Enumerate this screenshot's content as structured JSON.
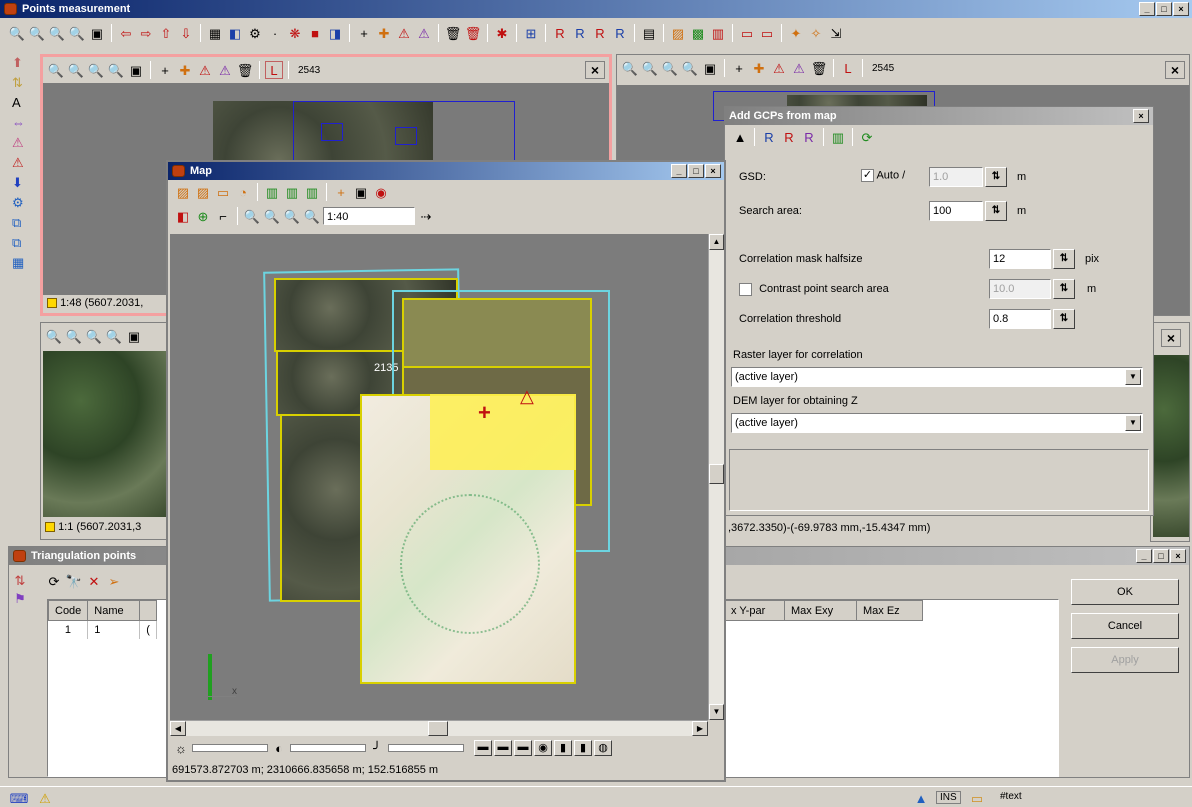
{
  "main_window": {
    "title": "Points measurement",
    "toolbar_icons": [
      "zoom-in-icon",
      "zoom-out-icon",
      "zoom-fit-icon",
      "zoom-area-icon",
      "zoom-box-icon",
      "arrow-left-icon",
      "arrow-right-icon",
      "arrow-up-icon",
      "arrow-down-icon",
      "grid-icon",
      "layer-icon",
      "settings-icon",
      "link-icon",
      "book-icon",
      "color-icon",
      "add-point-icon",
      "add-point-2-icon",
      "triangle-point-icon",
      "triangle-point-2-icon",
      "trash-icon",
      "trash-2-icon",
      "cross-icon",
      "measure-icon",
      "r-icon",
      "r-plus-icon",
      "r-label-icon",
      "r-question-icon",
      "report-icon",
      "map-icon",
      "grid-2-icon",
      "chart-icon",
      "window-icon",
      "window-2-icon",
      "point-tool-icon",
      "points-group-icon",
      "export-icon"
    ]
  },
  "top_left_view": {
    "image_id": "2543",
    "status": "1:48 (5607.2031,"
  },
  "top_right_view": {
    "image_id": "2545"
  },
  "bottom_left_view": {
    "status": "1:1 (5607.2031,3"
  },
  "map_window": {
    "title": "Map",
    "scale_value": "1:40",
    "image_label": "2135",
    "coordinates": "691573.872703 m; 2310666.835658 m; 152.516855 m"
  },
  "gcp_dialog": {
    "title": "Add GCPs from map",
    "gsd_label": "GSD:",
    "auto_label": "Auto /",
    "gsd_value": "1.0",
    "gsd_unit": "m",
    "search_area_label": "Search area:",
    "search_area_value": "100",
    "search_area_unit": "m",
    "corr_mask_label": "Correlation mask halfsize",
    "corr_mask_value": "12",
    "corr_mask_unit": "pix",
    "contrast_label": "Contrast point search area",
    "contrast_value": "10.0",
    "contrast_unit": "m",
    "corr_threshold_label": "Correlation threshold",
    "corr_threshold_value": "0.8",
    "raster_label": "Raster layer for correlation",
    "raster_value": "(active layer)",
    "dem_label": "DEM layer for obtaining Z",
    "dem_value": "(active layer)"
  },
  "right_view_status": ",3672.3350)-(-69.9783 mm,-15.4347 mm)",
  "triangulation": {
    "title": "Triangulation points",
    "columns": [
      "Code",
      "Name"
    ],
    "right_columns": [
      "x Y-par",
      "Max Exy",
      "Max Ez"
    ],
    "rows": [
      {
        "code": "1",
        "name": "1"
      }
    ]
  },
  "buttons": {
    "ok": "OK",
    "cancel": "Cancel",
    "apply": "Apply"
  },
  "statusbar": {
    "ins": "INS",
    "text": "#text"
  }
}
